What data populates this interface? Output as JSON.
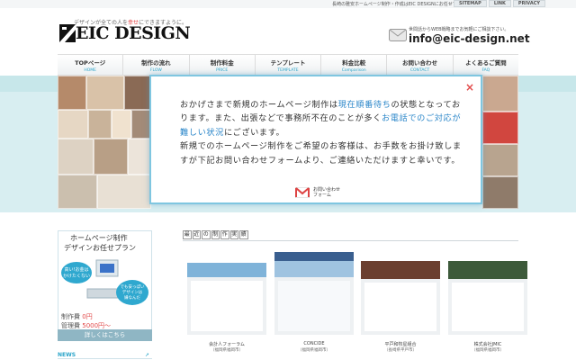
{
  "header": {
    "top_description": "長崎の雅安ホームページ制作・作成はEIC DESIGNにお任せ下さい。",
    "top_links": [
      "SITEMAP",
      "LINK",
      "PRIVACY"
    ],
    "logo_tagline_pre": "デザインが全ての人を",
    "logo_tagline_red": "幸せ",
    "logo_tagline_post": "にできますように。",
    "logo_text": "EIC DESIGN",
    "contact_note": "世間話からWEB戦略までお気軽にご相談下さい。",
    "contact_email": "info@eic-design.net"
  },
  "nav": {
    "items": [
      {
        "jp": "TOPページ",
        "en": "HOME"
      },
      {
        "jp": "制作の流れ",
        "en": "FLOW"
      },
      {
        "jp": "制作料金",
        "en": "PRICE"
      },
      {
        "jp": "テンプレート",
        "en": "TEMPLATE"
      },
      {
        "jp": "料金比較",
        "en": "Comparison"
      },
      {
        "jp": "お問い合わせ",
        "en": "CONTACT"
      },
      {
        "jp": "よくあるご質問",
        "en": "FAQ"
      }
    ]
  },
  "modal": {
    "close": "×",
    "p1": "おかげさまで新規のホームページ制作は",
    "p1_hl": "現在順番待ち",
    "p2": "の状態となっております。また、出張などで事務所不在のことが多く",
    "p2_hl": "お電話でのご対応が難しい状況",
    "p3": "にございます。",
    "p4": "新規でのホームページ制作をご希望のお客様は、お手数をお掛け致しますが下記お問い合わせフォームより、ご連絡いただけますと幸いです。",
    "button_line1": "お問い合わせ",
    "button_line2": "フォーム"
  },
  "promo": {
    "title1": "ホームページ制作",
    "title2": "デザインお任せプラン",
    "bubble1_l1": "高い!お金は",
    "bubble1_l2": "かけたくない",
    "bubble2_l1": "でも安っぽい",
    "bubble2_l2": "デザインは",
    "bubble2_l3": "嫌なんだ",
    "price1_label": "制作費 ",
    "price1_value": "0円",
    "price2_label": "管理費 ",
    "price2_value": "5000円〜",
    "button": "詳しくはこちら",
    "news": "NEWS",
    "news_arrow": "➚"
  },
  "works": {
    "title_chars": [
      "最",
      "近",
      "の",
      "制",
      "作",
      "実",
      "績"
    ],
    "items": [
      {
        "name": "会計人フォーラム",
        "place": "（福岡県福岡市）"
      },
      {
        "name": "CONCIDE",
        "place": "（福岡県福岡市）"
      },
      {
        "name": "平戸和牧星組合",
        "place": "（長崎県平戸市）"
      },
      {
        "name": "株式会社JMIC",
        "place": "（福岡県福岡市）"
      }
    ]
  },
  "colors": {
    "accent": "#29a4c9",
    "highlight": "#2a86c9",
    "close": "#e24a4a",
    "modal_border": "#7fc6e0"
  }
}
